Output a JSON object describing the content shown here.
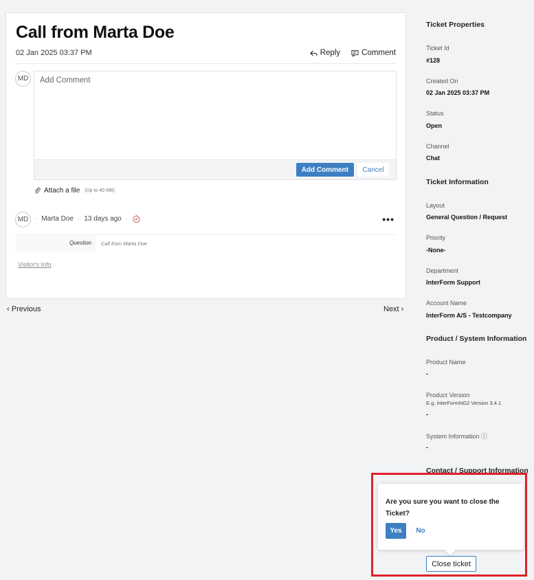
{
  "ticket": {
    "title": "Call from Marta Doe",
    "date": "02 Jan 2025 03:37 PM",
    "reply_label": "Reply",
    "comment_label": "Comment"
  },
  "comment_box": {
    "avatar_initials": "MD",
    "placeholder": "Add Comment",
    "submit_label": "Add Comment",
    "cancel_label": "Cancel",
    "attach_label": "Attach a file",
    "attach_limit": "(Up to 40 MB)"
  },
  "thread": {
    "avatar_initials": "MD",
    "author": "Marta Doe",
    "time_ago": "13 days ago",
    "question_label": "Question",
    "question_value": "Call from Marta Doe",
    "visitor_info_label": "Visitor's Info"
  },
  "nav": {
    "previous_label": "Previous",
    "next_label": "Next"
  },
  "properties": {
    "heading": "Ticket Properties",
    "ticket_id_label": "Ticket Id",
    "ticket_id": "#128",
    "created_on_label": "Created On",
    "created_on": "02 Jan 2025 03:37 PM",
    "status_label": "Status",
    "status": "Open",
    "channel_label": "Channel",
    "channel": "Chat",
    "ticket_info_heading": "Ticket Information",
    "layout_label": "Layout",
    "layout": "General Question / Request",
    "priority_label": "Priority",
    "priority": "-None-",
    "department_label": "Department",
    "department": "InterForm Support",
    "account_label": "Account Name",
    "account": "InterForm A/S - Testcompany",
    "product_heading": "Product / System Information",
    "product_name_label": "Product Name",
    "product_name": "-",
    "product_version_label": "Product Version",
    "product_version_hint": "E.g. InterFormNG2 Version 3.4.1",
    "product_version": "-",
    "system_info_label": "System Information",
    "system_info": "-",
    "contact_heading": "Contact / Support Information"
  },
  "close_dialog": {
    "question": "Are you sure you want to close the Ticket?",
    "yes_label": "Yes",
    "no_label": "No",
    "close_ticket_label": "Close ticket"
  },
  "colors": {
    "accent": "#3d7fc2",
    "highlight": "#e0202a"
  }
}
